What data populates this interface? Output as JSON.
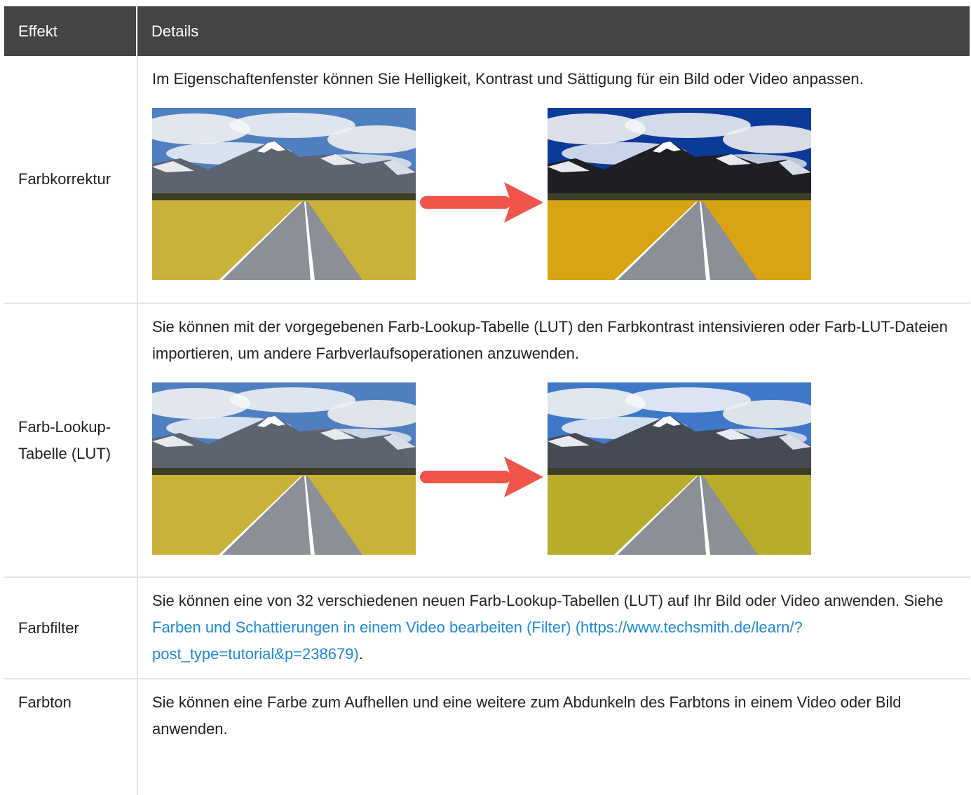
{
  "table": {
    "header": {
      "effect": "Effekt",
      "details": "Details"
    },
    "rows": [
      {
        "effect": "Farbkorrektur",
        "text": "Im Eigenschaftenfenster können Sie Helligkeit, Kontrast und Sättigung für ein Bild oder Video anpassen."
      },
      {
        "effect": "Farb-Lookup-Tabelle (LUT)",
        "text": "Sie können mit der vorgegebenen Farb-Lookup-Tabelle (LUT) den Farbkontrast intensivieren oder Farb-LUT-Dateien importieren, um andere Farbverlaufsoperationen anzuwenden."
      },
      {
        "effect": "Farbfilter",
        "text_before": "Sie können eine von 32 verschiedenen neuen Farb-Lookup-Tabellen (LUT) auf Ihr Bild oder Video anwenden. Siehe ",
        "link": "Farben und Schattierungen in einem Video bearbeiten (Filter) (https://www.techsmith.de/learn/?post_type=tutorial&p=238679)",
        "text_after": "."
      },
      {
        "effect": "Farbton",
        "text": "Sie können eine Farbe zum Aufhellen und eine weitere zum Abdunkeln des Farbtons in einem Video oder Bild anwenden."
      }
    ]
  },
  "colors": {
    "header_bg": "#444444",
    "link": "#1e88d8",
    "arrow": "#f0544a",
    "border": "#e3e3e3"
  }
}
